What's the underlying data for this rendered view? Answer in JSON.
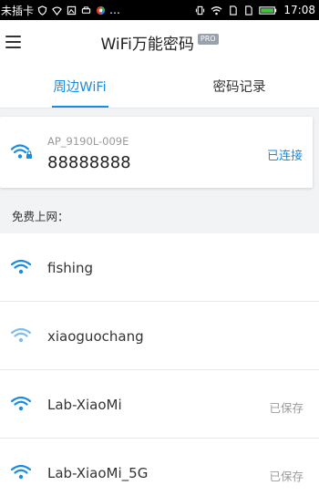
{
  "status_bar": {
    "carrier": "未插卡",
    "time": "17:08",
    "more": "…"
  },
  "header": {
    "menu_icon": "hamburger-menu-icon",
    "title": "WiFi万能密码",
    "badge": "PRO"
  },
  "tabs": [
    {
      "label": "周边WiFi",
      "active": true
    },
    {
      "label": "密码记录",
      "active": false
    }
  ],
  "connected": {
    "ssid": "AP_9190L-009E",
    "password": "88888888",
    "status": "已连接",
    "icon": "wifi-locked-icon"
  },
  "section_label": "免费上网：",
  "networks": [
    {
      "name": "fishing",
      "status": "",
      "signal": "full"
    },
    {
      "name": "xiaoguochang",
      "status": "",
      "signal": "weak"
    },
    {
      "name": "Lab-XiaoMi",
      "status": "已保存",
      "signal": "full"
    },
    {
      "name": "Lab-XiaoMi_5G",
      "status": "已保存",
      "signal": "full"
    }
  ],
  "colors": {
    "accent": "#1a8cdf",
    "wifi_full": "#1a8cdf",
    "wifi_weak": "#7fbcec",
    "secondary_text": "#9a9a9a"
  }
}
